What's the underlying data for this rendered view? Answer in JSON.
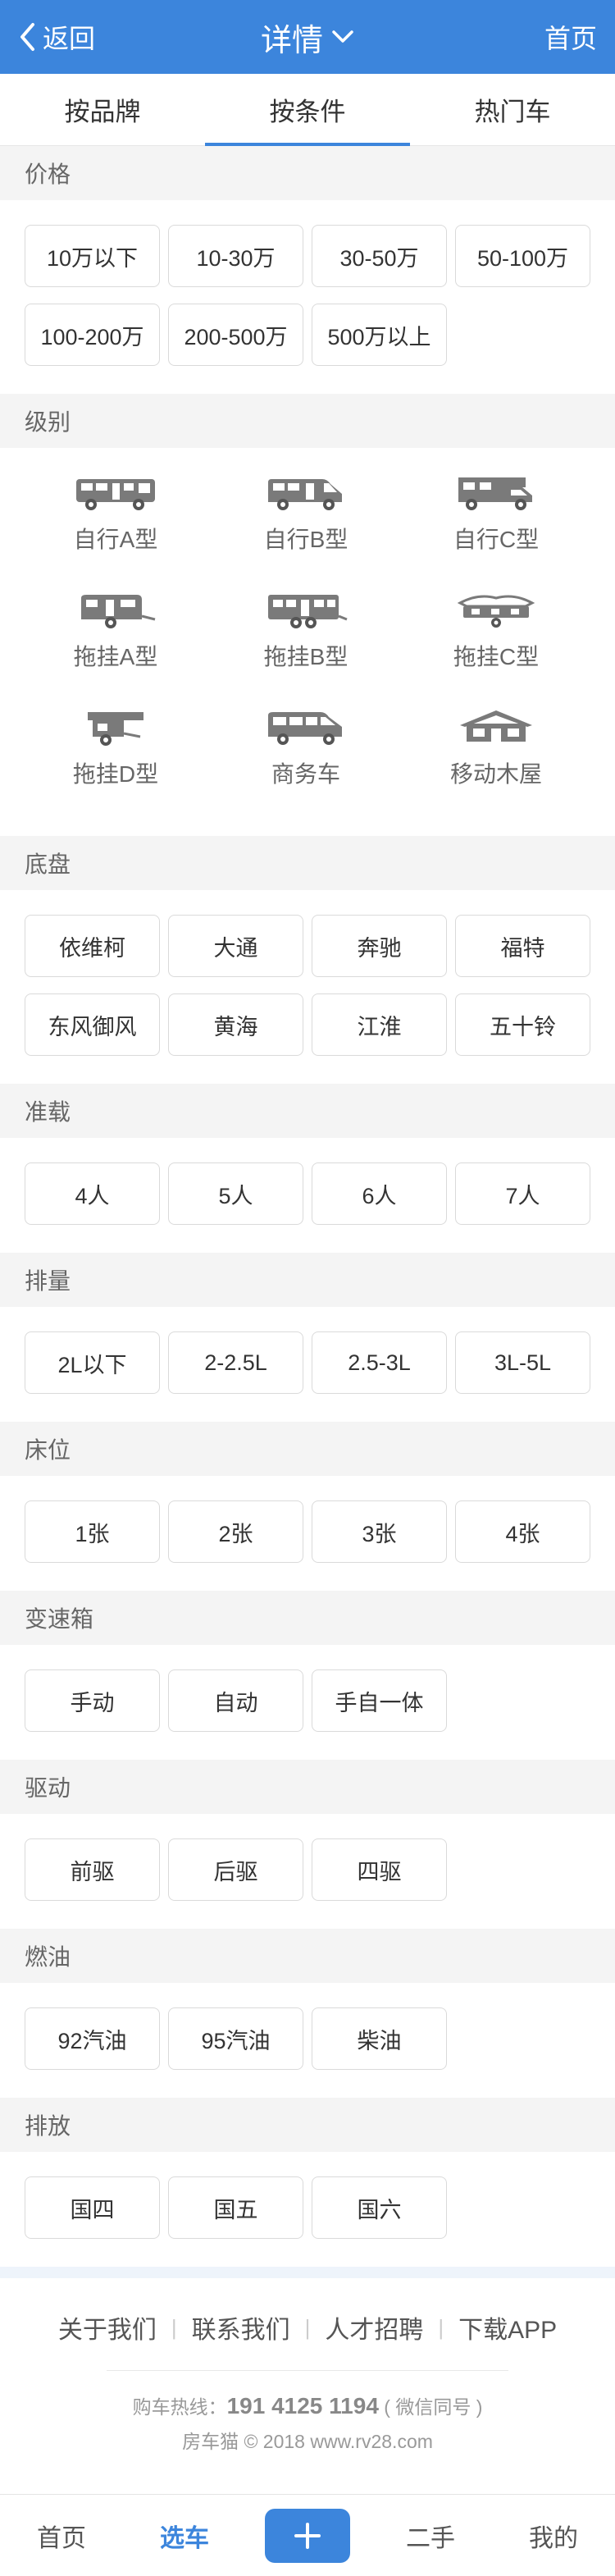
{
  "header": {
    "back_label": "返回",
    "title": "详情",
    "home_label": "首页"
  },
  "tabs": [
    {
      "label": "按品牌",
      "active": false
    },
    {
      "label": "按条件",
      "active": true
    },
    {
      "label": "热门车",
      "active": false
    }
  ],
  "sections": {
    "price": {
      "title": "价格",
      "options": [
        "10万以下",
        "10-30万",
        "30-50万",
        "50-100万",
        "100-200万",
        "200-500万",
        "500万以上"
      ]
    },
    "level": {
      "title": "级别",
      "items": [
        {
          "label": "自行A型",
          "icon": "rv-class-a-icon"
        },
        {
          "label": "自行B型",
          "icon": "rv-class-b-icon"
        },
        {
          "label": "自行C型",
          "icon": "rv-class-c-icon"
        },
        {
          "label": "拖挂A型",
          "icon": "trailer-a-icon"
        },
        {
          "label": "拖挂B型",
          "icon": "trailer-b-icon"
        },
        {
          "label": "拖挂C型",
          "icon": "trailer-c-icon"
        },
        {
          "label": "拖挂D型",
          "icon": "trailer-d-icon"
        },
        {
          "label": "商务车",
          "icon": "business-van-icon"
        },
        {
          "label": "移动木屋",
          "icon": "mobile-cabin-icon"
        }
      ]
    },
    "chassis": {
      "title": "底盘",
      "options": [
        "依维柯",
        "大通",
        "奔驰",
        "福特",
        "东风御风",
        "黄海",
        "江淮",
        "五十铃"
      ]
    },
    "capacity": {
      "title": "准载",
      "options": [
        "4人",
        "5人",
        "6人",
        "7人"
      ]
    },
    "displacement": {
      "title": "排量",
      "options": [
        "2L以下",
        "2-2.5L",
        "2.5-3L",
        "3L-5L"
      ]
    },
    "beds": {
      "title": "床位",
      "options": [
        "1张",
        "2张",
        "3张",
        "4张"
      ]
    },
    "gearbox": {
      "title": "变速箱",
      "options": [
        "手动",
        "自动",
        "手自一体"
      ]
    },
    "drive": {
      "title": "驱动",
      "options": [
        "前驱",
        "后驱",
        "四驱"
      ]
    },
    "fuel": {
      "title": "燃油",
      "options": [
        "92汽油",
        "95汽油",
        "柴油"
      ]
    },
    "emission": {
      "title": "排放",
      "options": [
        "国四",
        "国五",
        "国六"
      ]
    }
  },
  "footer": {
    "links": [
      "关于我们",
      "联系我们",
      "人才招聘",
      "下载APP"
    ],
    "hotline_label": "购车热线：",
    "hotline_number": "191 4125 1194",
    "hotline_note": "( 微信同号 )",
    "copyright": "房车猫 © 2018 www.rv28.com"
  },
  "bottom_nav": {
    "items": [
      "首页",
      "选车",
      "二手",
      "我的"
    ],
    "active": "选车",
    "plus_icon": "plus-icon"
  },
  "colors": {
    "accent": "#3c85dc",
    "section_bg": "#f4f4f4"
  }
}
